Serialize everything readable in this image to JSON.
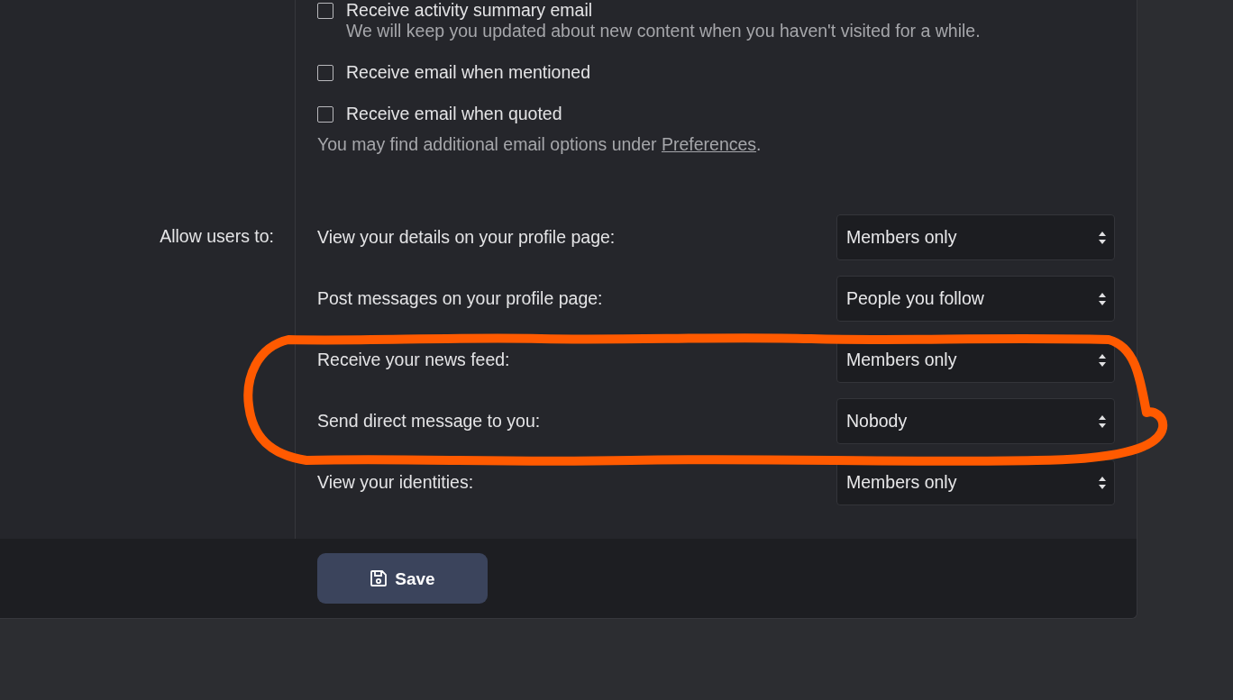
{
  "checkboxes": [
    {
      "label": "Receive activity summary email",
      "description": "We will keep you updated about new content when you haven't visited for a while.",
      "checked": false
    },
    {
      "label": "Receive email when mentioned",
      "checked": false
    },
    {
      "label": "Receive email when quoted",
      "checked": false
    }
  ],
  "email_note": {
    "text": "You may find additional email options under ",
    "link": "Preferences",
    "suffix": "."
  },
  "privacy": {
    "label": "Allow users to:",
    "rows": [
      {
        "label": "View your details on your profile page:",
        "value": "Members only"
      },
      {
        "label": "Post messages on your profile page:",
        "value": "People you follow"
      },
      {
        "label": "Receive your news feed:",
        "value": "Members only"
      },
      {
        "label": "Send direct message to you:",
        "value": "Nobody"
      },
      {
        "label": "View your identities:",
        "value": "Members only"
      }
    ]
  },
  "save_button": {
    "label": "Save"
  }
}
